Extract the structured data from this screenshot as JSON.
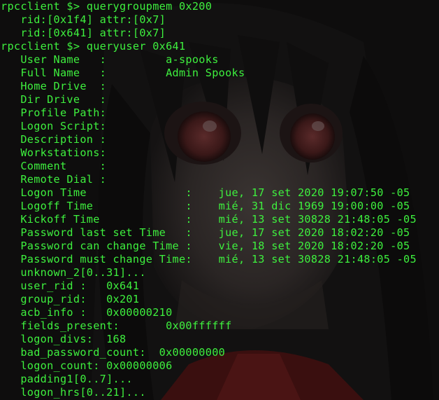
{
  "terminal": {
    "text_color": "#3ef03e",
    "lines": [
      "rpcclient $> querygroupmem 0x200",
      "   rid:[0x1f4] attr:[0x7]",
      "   rid:[0x641] attr:[0x7]",
      "rpcclient $> queryuser 0x641",
      "   User Name   :         a-spooks",
      "   Full Name   :         Admin Spooks",
      "   Home Drive  :",
      "   Dir Drive   :",
      "   Profile Path:",
      "   Logon Script:",
      "   Description :",
      "   Workstations:",
      "   Comment     :",
      "   Remote Dial :",
      "   Logon Time               :    jue, 17 set 2020 19:07:50 -05",
      "   Logoff Time              :    mié, 31 dic 1969 19:00:00 -05",
      "   Kickoff Time             :    mié, 13 set 30828 21:48:05 -05",
      "   Password last set Time   :    jue, 17 set 2020 18:02:20 -05",
      "   Password can change Time :    vie, 18 set 2020 18:02:20 -05",
      "   Password must change Time:    mié, 13 set 30828 21:48:05 -05",
      "   unknown_2[0..31]...",
      "   user_rid :   0x641",
      "   group_rid:   0x201",
      "   acb_info :   0x00000210",
      "   fields_present:       0x00ffffff",
      "   logon_divs:  168",
      "   bad_password_count:  0x00000000",
      "   logon_count: 0x00000006",
      "   padding1[0..7]...",
      "   logon_hrs[0..21]..."
    ]
  }
}
